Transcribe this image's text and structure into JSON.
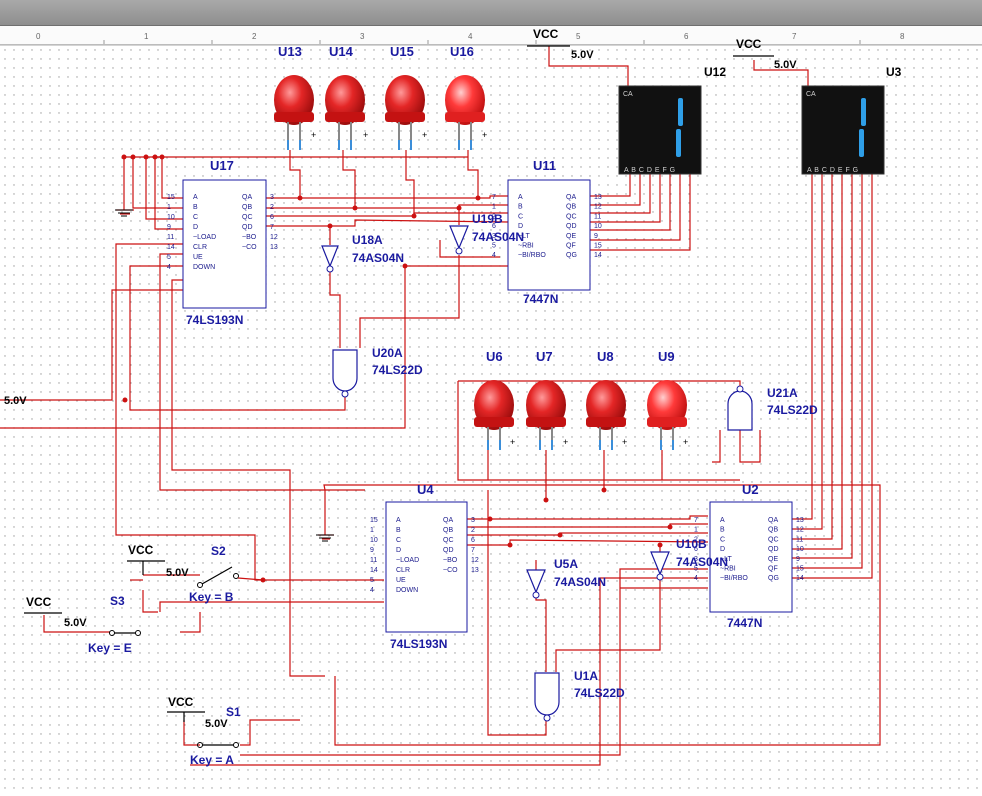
{
  "window": {
    "titlebar_color": "#9a9a9a"
  },
  "ruler": {
    "ticks": [
      "0",
      "1",
      "2",
      "3",
      "4",
      "5",
      "6",
      "7",
      "8"
    ]
  },
  "colors": {
    "wire": "#cc1111",
    "label": "#1a1aa0",
    "led_on": "#ff3030",
    "led": "#dd1e1e",
    "display_bg": "#111111",
    "segment": "#2f9fe8",
    "grid_dot": "#9a9a9a"
  },
  "supplies": [
    {
      "id": "vcc1",
      "name": "VCC",
      "voltage": "5.0V"
    },
    {
      "id": "vcc2",
      "name": "VCC",
      "voltage": "5.0V"
    },
    {
      "id": "vcc3",
      "name": "VCC",
      "voltage": "5.0V"
    },
    {
      "id": "vcc4",
      "name": "VCC",
      "voltage": "5.0V"
    },
    {
      "id": "vcc5",
      "name": "VCC",
      "voltage": "5.0V"
    }
  ],
  "side_voltage": "5.0V",
  "switches": [
    {
      "ref": "S2",
      "key": "Key = B"
    },
    {
      "ref": "S3",
      "key": "Key = E"
    },
    {
      "ref": "S1",
      "key": "Key = A"
    }
  ],
  "leds_top": [
    "U13",
    "U14",
    "U15",
    "U16"
  ],
  "leds_mid": [
    "U6",
    "U7",
    "U8",
    "U9"
  ],
  "counters": [
    {
      "ref": "U17",
      "part": "74LS193N",
      "left_pins": [
        [
          "15",
          "A"
        ],
        [
          "1",
          "B"
        ],
        [
          "10",
          "C"
        ],
        [
          "9",
          "D"
        ],
        [
          "11",
          "~LOAD"
        ],
        [
          "14",
          "CLR"
        ],
        [
          "5",
          "UE"
        ],
        [
          "4",
          "DOWN"
        ]
      ],
      "right_pins": [
        [
          "3",
          "QA"
        ],
        [
          "2",
          "QB"
        ],
        [
          "6",
          "QC"
        ],
        [
          "7",
          "QD"
        ],
        [
          "12",
          "~BO"
        ],
        [
          "13",
          "~CO"
        ]
      ]
    },
    {
      "ref": "U4",
      "part": "74LS193N",
      "left_pins": [
        [
          "15",
          "A"
        ],
        [
          "1",
          "B"
        ],
        [
          "10",
          "C"
        ],
        [
          "9",
          "D"
        ],
        [
          "11",
          "~LOAD"
        ],
        [
          "14",
          "CLR"
        ],
        [
          "5",
          "UE"
        ],
        [
          "4",
          "DOWN"
        ]
      ],
      "right_pins": [
        [
          "3",
          "QA"
        ],
        [
          "2",
          "QB"
        ],
        [
          "6",
          "QC"
        ],
        [
          "7",
          "QD"
        ],
        [
          "12",
          "~BO"
        ],
        [
          "13",
          "~CO"
        ]
      ]
    }
  ],
  "decoders": [
    {
      "ref": "U11",
      "part": "7447N",
      "left_pins": [
        [
          "7",
          "A"
        ],
        [
          "1",
          "B"
        ],
        [
          "2",
          "C"
        ],
        [
          "6",
          "D"
        ],
        [
          "3",
          "~LT"
        ],
        [
          "5",
          "~RBI"
        ],
        [
          "4",
          "~BI/RBO"
        ]
      ],
      "right_pins": [
        [
          "13",
          "QA"
        ],
        [
          "12",
          "QB"
        ],
        [
          "11",
          "QC"
        ],
        [
          "10",
          "QD"
        ],
        [
          "9",
          "QE"
        ],
        [
          "15",
          "QF"
        ],
        [
          "14",
          "QG"
        ]
      ]
    },
    {
      "ref": "U2",
      "part": "7447N",
      "left_pins": [
        [
          "7",
          "A"
        ],
        [
          "1",
          "B"
        ],
        [
          "2",
          "C"
        ],
        [
          "6",
          "D"
        ],
        [
          "3",
          "~LT"
        ],
        [
          "5",
          "~RBI"
        ],
        [
          "4",
          "~BI/RBO"
        ]
      ],
      "right_pins": [
        [
          "13",
          "QA"
        ],
        [
          "12",
          "QB"
        ],
        [
          "11",
          "QC"
        ],
        [
          "10",
          "QD"
        ],
        [
          "9",
          "QE"
        ],
        [
          "15",
          "QF"
        ],
        [
          "14",
          "QG"
        ]
      ]
    }
  ],
  "inverters": [
    {
      "ref": "U18A",
      "part": "74AS04N"
    },
    {
      "ref": "U19B",
      "part": "74AS04N"
    },
    {
      "ref": "U5A",
      "part": "74AS04N"
    },
    {
      "ref": "U10B",
      "part": "74AS04N"
    }
  ],
  "nand_gates": [
    {
      "ref": "U20A",
      "part": "74LS22D"
    },
    {
      "ref": "U21A",
      "part": "74LS22D"
    },
    {
      "ref": "U1A",
      "part": "74LS22D"
    }
  ],
  "displays": [
    {
      "ref": "U12",
      "mode": "CA",
      "pins": "A B C D E F G",
      "digit": "1"
    },
    {
      "ref": "U3",
      "mode": "CA",
      "pins": "A B C D E F G",
      "digit": "1"
    }
  ]
}
